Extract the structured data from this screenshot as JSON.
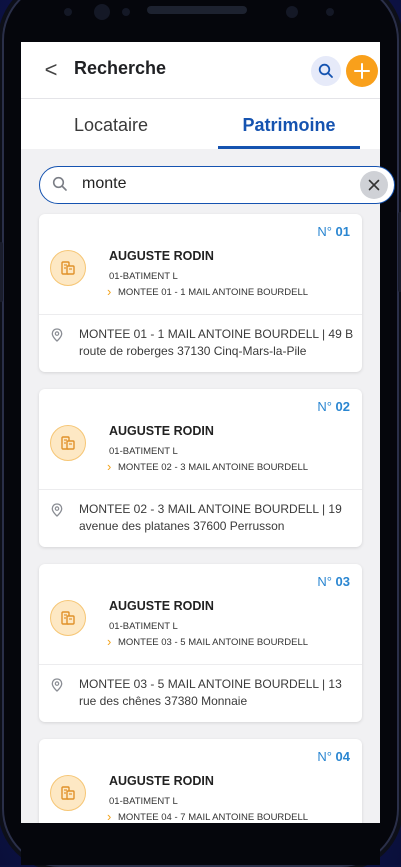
{
  "header": {
    "back_glyph": "<",
    "title": "Recherche"
  },
  "tabs": [
    {
      "label": "Locataire",
      "active": false
    },
    {
      "label": "Patrimoine",
      "active": true
    }
  ],
  "search": {
    "value": "monte"
  },
  "colors": {
    "accent_blue": "#1553b0",
    "number_blue": "#2a86d1",
    "accent_orange": "#f9a01b"
  },
  "results": [
    {
      "num_prefix": "N°",
      "num": "01",
      "name": "AUGUSTE RODIN",
      "batiment": "01-BATIMENT L",
      "montee": "MONTEE 01 - 1 MAIL ANTOINE BOURDELL",
      "address": "MONTEE 01 - 1 MAIL ANTOINE BOURDELL | 49 B route de roberges 37130 Cinq-Mars-la-Pile"
    },
    {
      "num_prefix": "N°",
      "num": "02",
      "name": "AUGUSTE RODIN",
      "batiment": "01-BATIMENT L",
      "montee": "MONTEE 02 - 3 MAIL ANTOINE BOURDELL",
      "address": "MONTEE 02 - 3 MAIL ANTOINE BOURDELL | 19 avenue des platanes 37600 Perrusson"
    },
    {
      "num_prefix": "N°",
      "num": "03",
      "name": "AUGUSTE RODIN",
      "batiment": "01-BATIMENT L",
      "montee": "MONTEE 03 - 5 MAIL ANTOINE BOURDELL",
      "address": "MONTEE 03 - 5 MAIL ANTOINE BOURDELL | 13 rue des chênes 37380 Monnaie"
    },
    {
      "num_prefix": "N°",
      "num": "04",
      "name": "AUGUSTE RODIN",
      "batiment": "01-BATIMENT L",
      "montee": "MONTEE 04 - 7 MAIL ANTOINE BOURDELL",
      "address": ""
    }
  ]
}
